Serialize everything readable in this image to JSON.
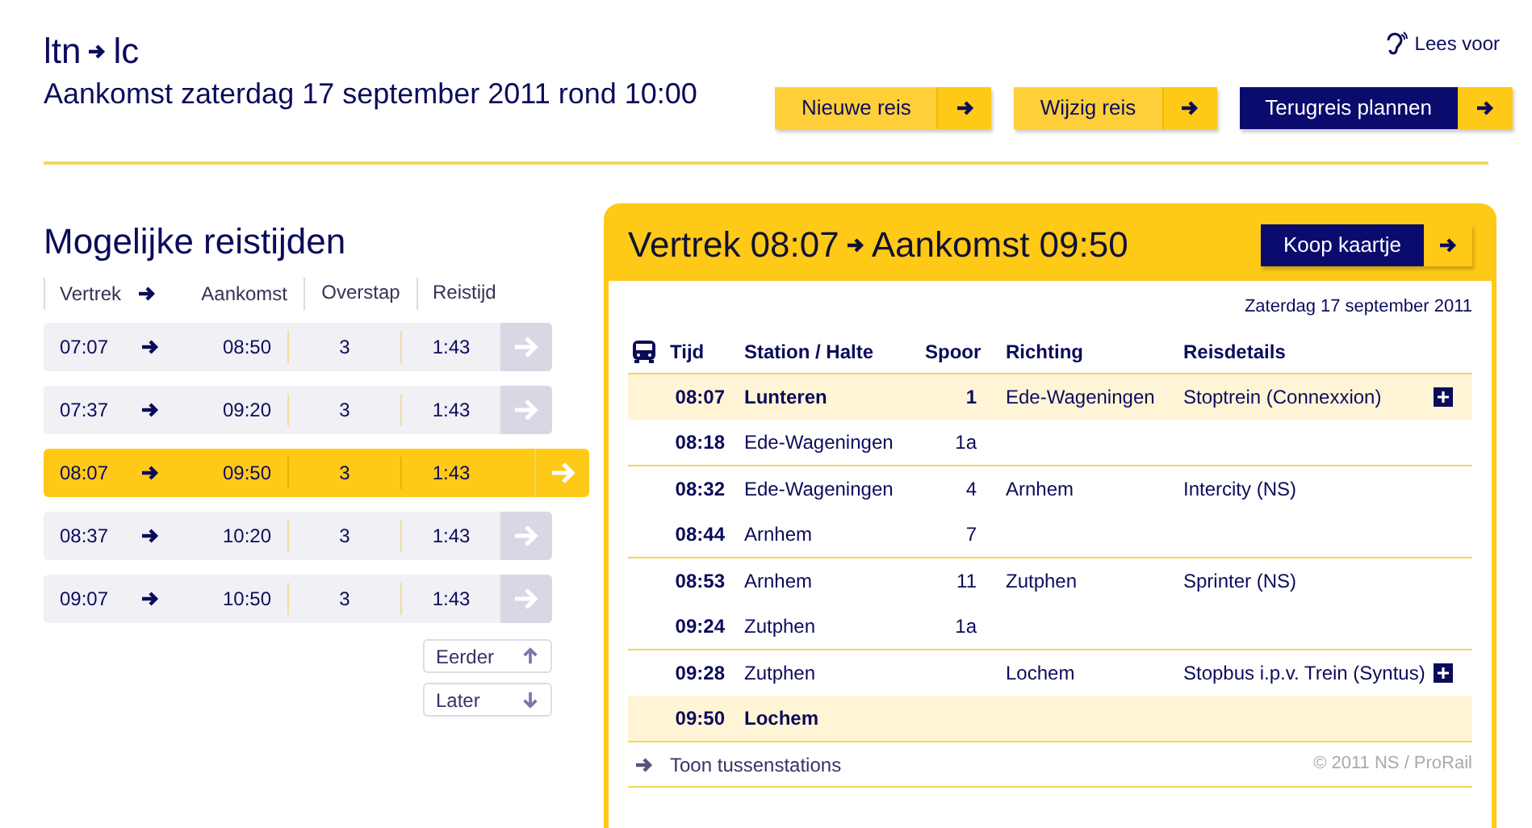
{
  "header": {
    "from": "ltn",
    "to": "lc",
    "subtitle": "Aankomst zaterdag 17 september 2011 rond 10:00",
    "read_aloud": "Lees voor"
  },
  "actions": [
    {
      "label": "Nieuwe reis",
      "kind": "light"
    },
    {
      "label": "Wijzig reis",
      "kind": "light"
    },
    {
      "label": "Terugreis plannen",
      "kind": "dark"
    }
  ],
  "options": {
    "title": "Mogelijke reistijden",
    "columns": [
      "Vertrek",
      "Aankomst",
      "Overstap",
      "Reistijd"
    ],
    "rows": [
      {
        "departure": "07:07",
        "arrival": "08:50",
        "transfers": "3",
        "duration": "1:43",
        "selected": false
      },
      {
        "departure": "07:37",
        "arrival": "09:20",
        "transfers": "3",
        "duration": "1:43",
        "selected": false
      },
      {
        "departure": "08:07",
        "arrival": "09:50",
        "transfers": "3",
        "duration": "1:43",
        "selected": true
      },
      {
        "departure": "08:37",
        "arrival": "10:20",
        "transfers": "3",
        "duration": "1:43",
        "selected": false
      },
      {
        "departure": "09:07",
        "arrival": "10:50",
        "transfers": "3",
        "duration": "1:43",
        "selected": false
      }
    ],
    "earlier": "Eerder",
    "later": "Later"
  },
  "detail": {
    "departure": "Vertrek 08:07",
    "arrival": "Aankomst 09:50",
    "buy": "Koop kaartje",
    "date": "Zaterdag 17 september 2011",
    "columns": [
      "Tijd",
      "Station / Halte",
      "Spoor",
      "Richting",
      "Reisdetails"
    ],
    "legs": [
      {
        "direction": "Ede-Wageningen",
        "details": "Stoptrein (Connexxion)",
        "expandable": true,
        "stops": [
          {
            "time": "08:07",
            "station": "Lunteren",
            "platform": "1",
            "endpoint": true
          },
          {
            "time": "08:18",
            "station": "Ede-Wageningen",
            "platform": "1a",
            "endpoint": false
          }
        ]
      },
      {
        "direction": "Arnhem",
        "details": "Intercity (NS)",
        "expandable": false,
        "stops": [
          {
            "time": "08:32",
            "station": "Ede-Wageningen",
            "platform": "4",
            "endpoint": false
          },
          {
            "time": "08:44",
            "station": "Arnhem",
            "platform": "7",
            "endpoint": false
          }
        ]
      },
      {
        "direction": "Zutphen",
        "details": "Sprinter (NS)",
        "expandable": false,
        "stops": [
          {
            "time": "08:53",
            "station": "Arnhem",
            "platform": "11",
            "endpoint": false
          },
          {
            "time": "09:24",
            "station": "Zutphen",
            "platform": "1a",
            "endpoint": false
          }
        ]
      },
      {
        "direction": "Lochem",
        "details": "Stopbus i.p.v. Trein (Syntus)",
        "expandable": true,
        "stops": [
          {
            "time": "09:28",
            "station": "Zutphen",
            "endpoint": false
          },
          {
            "time": "09:50",
            "station": "Lochem",
            "endpoint": true
          }
        ]
      }
    ],
    "show_stops": "Toon tussenstations",
    "copyright": "© 2011 NS / ProRail"
  }
}
